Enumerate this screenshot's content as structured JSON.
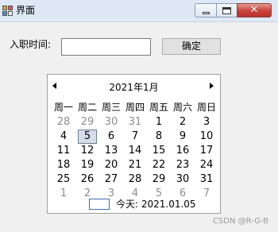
{
  "window": {
    "title": "界面",
    "app_icon": "winforms-app-icon",
    "buttons": {
      "minimize": "minimize-icon",
      "maximize": "maximize-icon",
      "close": "close-icon"
    }
  },
  "form": {
    "hire_time_label": "入职时间:",
    "hire_time_value": "",
    "ok_button": "确定"
  },
  "calendar": {
    "month_title": "2021年1月",
    "weekdays": [
      "周一",
      "周二",
      "周三",
      "周四",
      "周五",
      "周六",
      "周日"
    ],
    "weeks": [
      [
        {
          "d": "28",
          "o": true
        },
        {
          "d": "29",
          "o": true
        },
        {
          "d": "30",
          "o": true
        },
        {
          "d": "31",
          "o": true
        },
        {
          "d": "1"
        },
        {
          "d": "2"
        },
        {
          "d": "3"
        }
      ],
      [
        {
          "d": "4"
        },
        {
          "d": "5",
          "t": true
        },
        {
          "d": "6"
        },
        {
          "d": "7"
        },
        {
          "d": "8"
        },
        {
          "d": "9"
        },
        {
          "d": "10"
        }
      ],
      [
        {
          "d": "11"
        },
        {
          "d": "12"
        },
        {
          "d": "13"
        },
        {
          "d": "14"
        },
        {
          "d": "15"
        },
        {
          "d": "16"
        },
        {
          "d": "17"
        }
      ],
      [
        {
          "d": "18"
        },
        {
          "d": "19"
        },
        {
          "d": "20"
        },
        {
          "d": "21"
        },
        {
          "d": "22"
        },
        {
          "d": "23"
        },
        {
          "d": "24"
        }
      ],
      [
        {
          "d": "25"
        },
        {
          "d": "26"
        },
        {
          "d": "27"
        },
        {
          "d": "28"
        },
        {
          "d": "29"
        },
        {
          "d": "30"
        },
        {
          "d": "31"
        }
      ],
      [
        {
          "d": "1",
          "o": true
        },
        {
          "d": "2",
          "o": true
        },
        {
          "d": "3",
          "o": true
        },
        {
          "d": "4",
          "o": true
        },
        {
          "d": "5",
          "o": true
        },
        {
          "d": "6",
          "o": true
        },
        {
          "d": "7",
          "o": true
        }
      ]
    ],
    "today_label": "今天: 2021.01.05"
  },
  "watermark": "CSDN @R-G-B"
}
